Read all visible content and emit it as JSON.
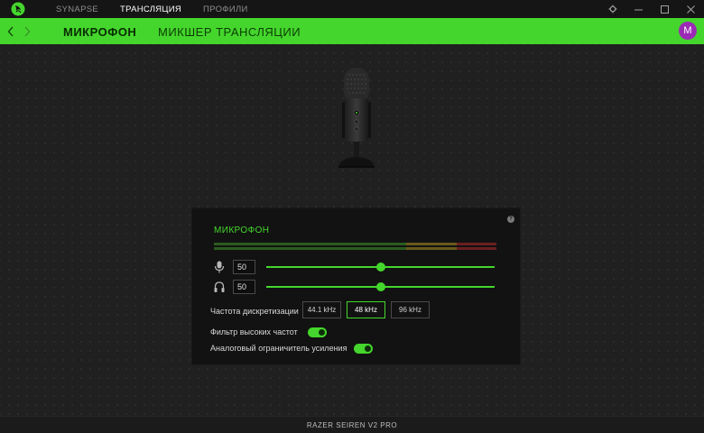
{
  "titlebar": {
    "nav": [
      {
        "label": "SYNAPSE",
        "active": false
      },
      {
        "label": "ТРАНСЛЯЦИЯ",
        "active": true
      },
      {
        "label": "ПРОФИЛИ",
        "active": false
      }
    ],
    "icons": [
      "razer-logo-icon",
      "gear-icon",
      "minimize-icon",
      "maximize-icon",
      "close-icon"
    ]
  },
  "header": {
    "tabs": [
      {
        "label": "МИКРОФОН",
        "active": true
      },
      {
        "label": "МИКШЕР ТРАНСЛЯЦИИ",
        "active": false
      }
    ],
    "avatar_letter": "M",
    "accent_color": "#44d62c",
    "avatar_color": "#9b2bb5"
  },
  "panel": {
    "title": "МИКРОФОН",
    "help_glyph": "?",
    "mic_gain": {
      "value": "50",
      "level": 0.5
    },
    "monitor_volume": {
      "value": "50",
      "level": 0.5
    },
    "sample_rate": {
      "label": "Частота дискретизации",
      "options": [
        "44.1 kHz",
        "48 kHz",
        "96 kHz"
      ],
      "selected": "48 kHz"
    },
    "high_pass_filter": {
      "label": "Фильтр высоких частот",
      "enabled": true
    },
    "analog_limiter": {
      "label": "Аналоговый ограничитель усиления",
      "enabled": true
    }
  },
  "footer": {
    "device_name": "RAZER SEIREN V2 PRO"
  }
}
